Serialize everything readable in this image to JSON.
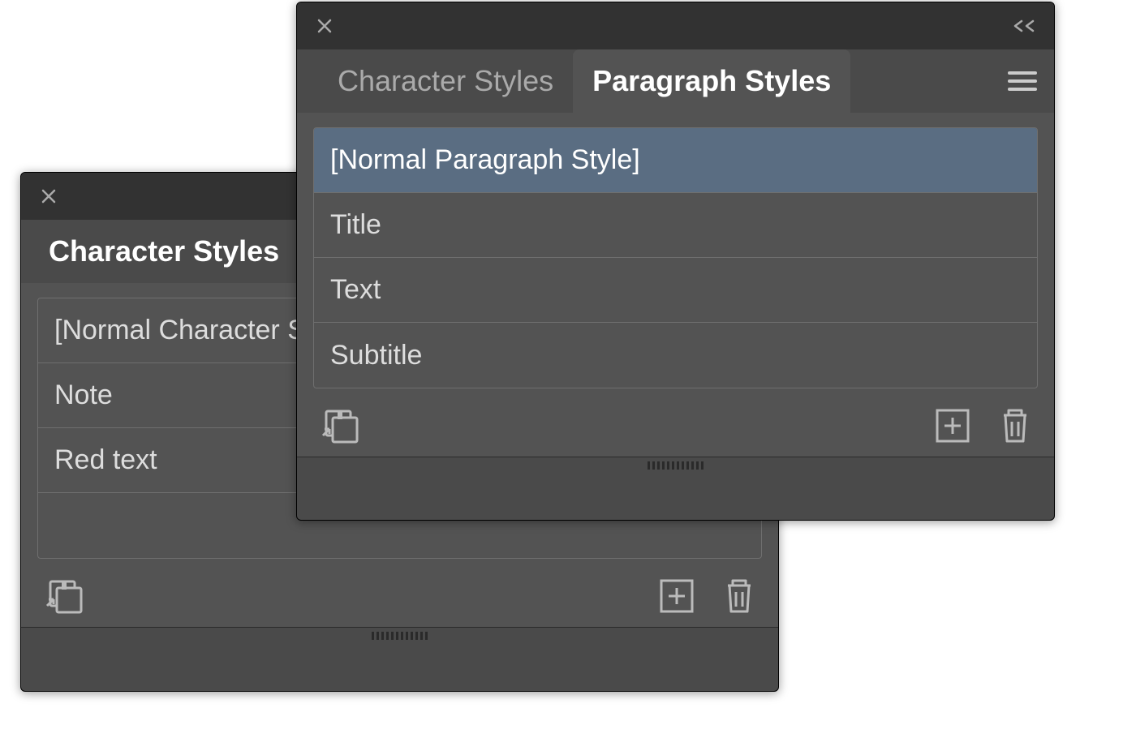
{
  "back_panel": {
    "tabs": [
      {
        "label": "Character Styles",
        "active": true
      }
    ],
    "styles": [
      {
        "label": "[Normal Character Style]",
        "selected": false
      },
      {
        "label": "Note",
        "selected": false
      },
      {
        "label": "Red text",
        "selected": false
      },
      {
        "label": "",
        "selected": false
      }
    ]
  },
  "front_panel": {
    "tabs": [
      {
        "label": "Character Styles",
        "active": false
      },
      {
        "label": "Paragraph Styles",
        "active": true
      }
    ],
    "styles": [
      {
        "label": "[Normal Paragraph Style]",
        "selected": true
      },
      {
        "label": "Title",
        "selected": false
      },
      {
        "label": "Text",
        "selected": false
      },
      {
        "label": "Subtitle",
        "selected": false
      }
    ]
  },
  "icons": {
    "close": "close-icon",
    "collapse": "collapse-icon",
    "menu": "menu-icon",
    "load": "load-styles-icon",
    "add": "add-style-icon",
    "trash": "delete-style-icon"
  }
}
